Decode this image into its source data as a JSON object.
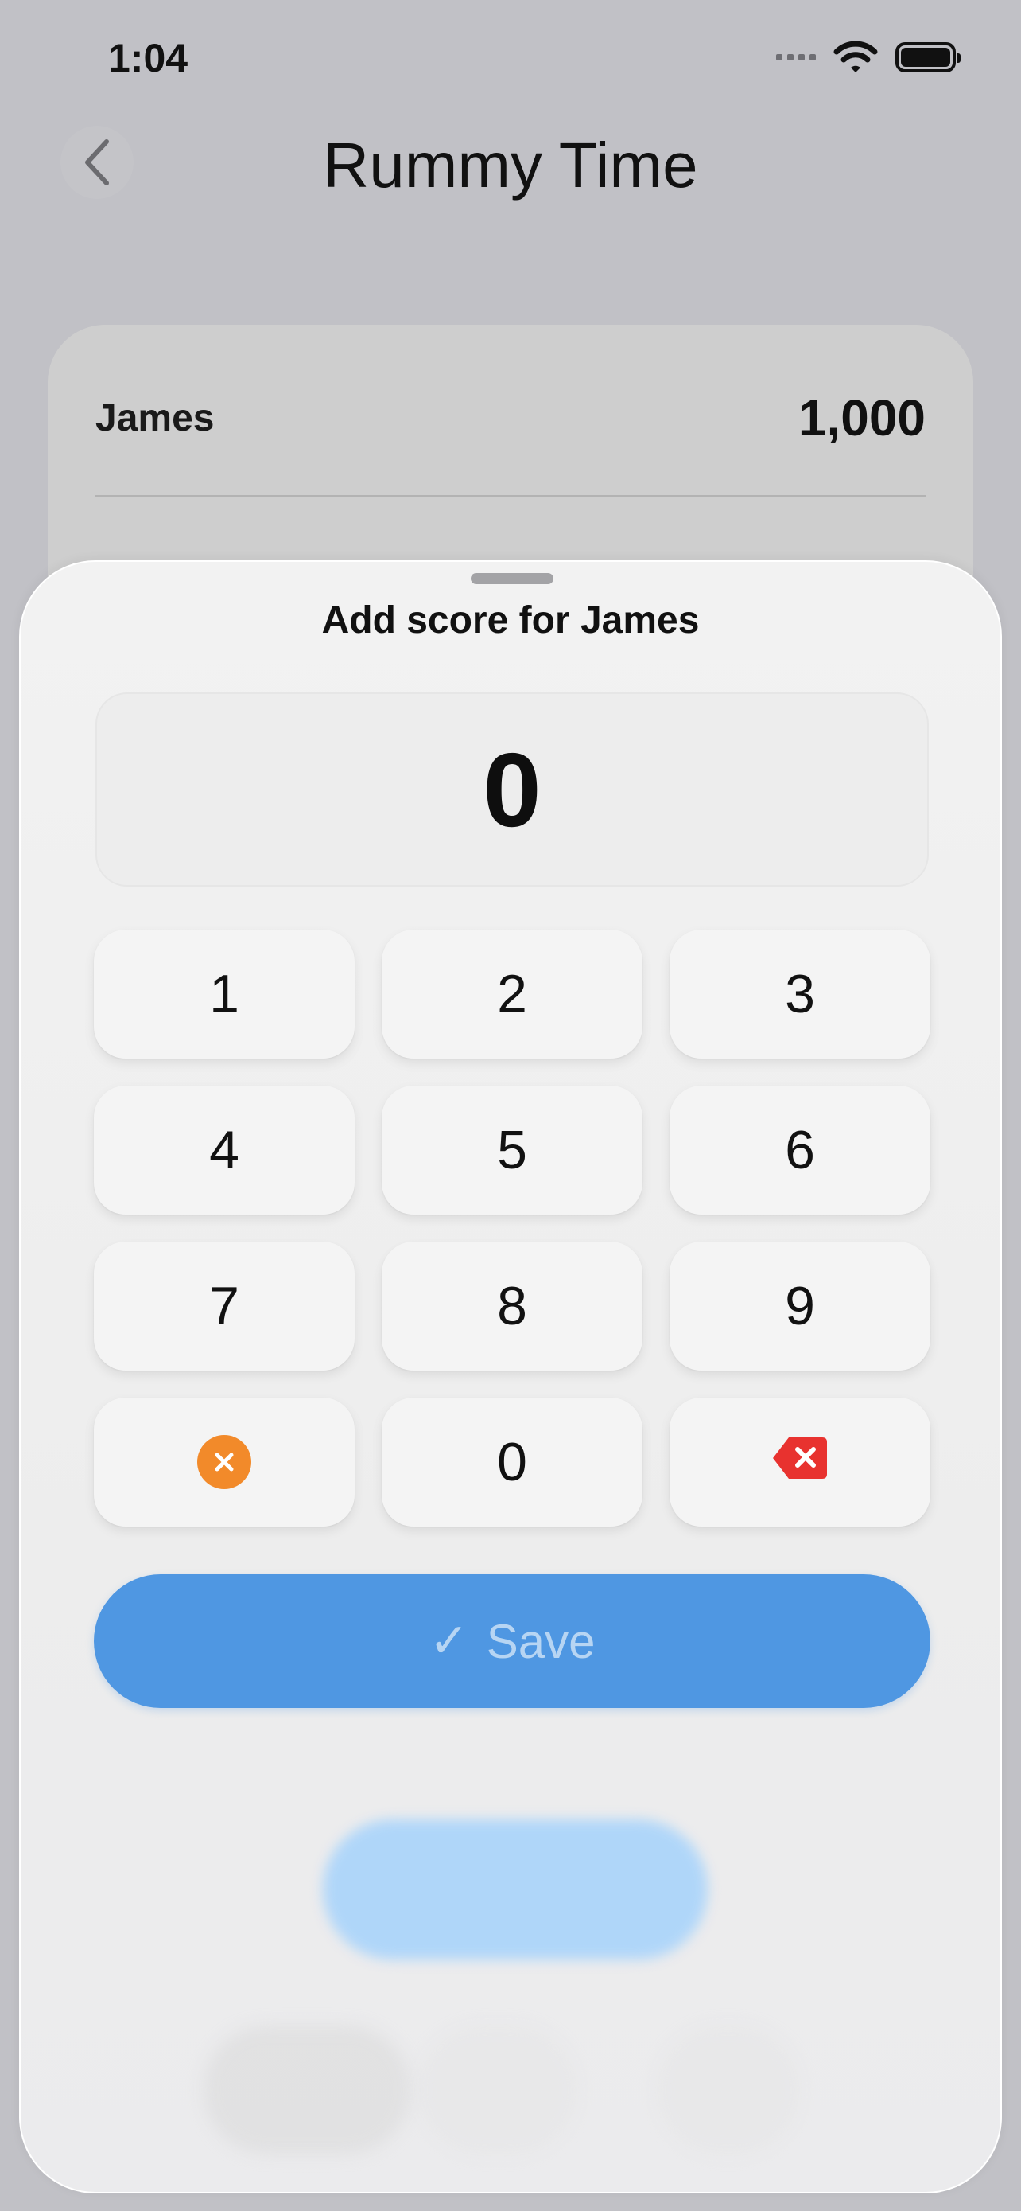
{
  "status_bar": {
    "time": "1:04"
  },
  "nav": {
    "title": "Rummy Time"
  },
  "background_card": {
    "player_name": "James",
    "player_score": "1,000"
  },
  "sheet": {
    "title": "Add score for James",
    "display_value": "0",
    "keys": {
      "k1": "1",
      "k2": "2",
      "k3": "3",
      "k4": "4",
      "k5": "5",
      "k6": "6",
      "k7": "7",
      "k8": "8",
      "k9": "9",
      "k0": "0"
    },
    "save_check": "✓",
    "save_label": "Save"
  },
  "colors": {
    "accent": "#4f97e2",
    "clear": "#f28a2a",
    "delete": "#e8322f"
  },
  "icons": [
    "back-chevron-icon",
    "wifi-icon",
    "battery-icon",
    "clear-icon",
    "backspace-icon",
    "checkmark-icon"
  ]
}
